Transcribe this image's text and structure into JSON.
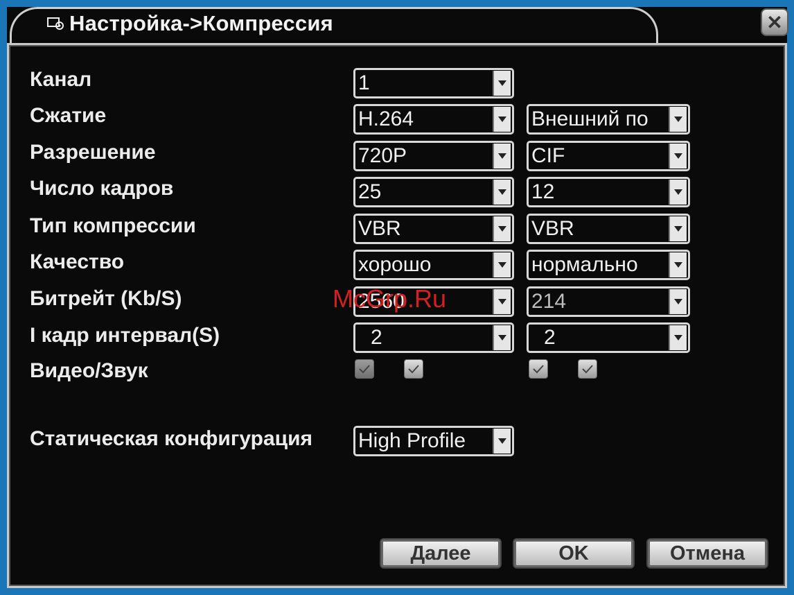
{
  "window": {
    "title": "Настройка->Компрессия",
    "close_label": "✕"
  },
  "rows": [
    {
      "label": "Канал",
      "main": "1",
      "extra": null
    },
    {
      "label": "Сжатие",
      "main": "H.264",
      "extra": "Внешний по"
    },
    {
      "label": "Разрешение",
      "main": "720P",
      "extra": "CIF"
    },
    {
      "label": "Число кадров",
      "main": "25",
      "extra": "12"
    },
    {
      "label": "Тип компрессии",
      "main": "VBR",
      "extra": "VBR"
    },
    {
      "label": "Качество",
      "main": "хорошо",
      "extra": "нормально"
    },
    {
      "label": "Битрейт (Kb/S)",
      "main": "2560",
      "extra": "214"
    },
    {
      "label": "I кадр интервал(S)",
      "main": "2",
      "extra": "2"
    }
  ],
  "video_audio": {
    "label": "Видео/Звук",
    "main_video": true,
    "main_audio": true,
    "extra_video": true,
    "extra_audio": true
  },
  "static_config": {
    "label": "Статическая конфигурация",
    "value": "High Profile"
  },
  "buttons": {
    "next": "Далее",
    "ok": "OK",
    "cancel": "Отмена"
  },
  "watermark": "McGrp.Ru"
}
